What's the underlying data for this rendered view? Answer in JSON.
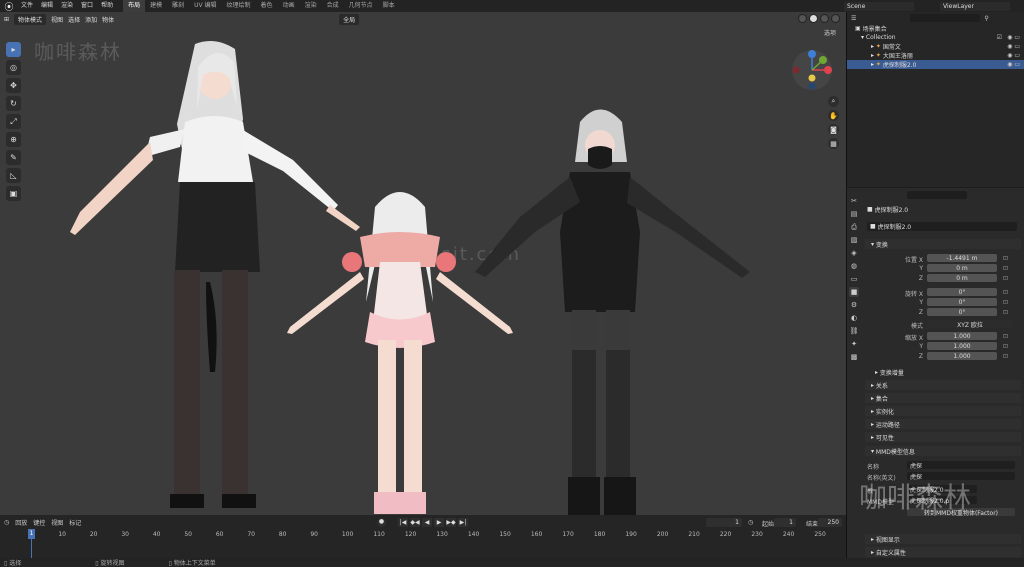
{
  "menu": {
    "file": "文件",
    "edit": "编辑",
    "render": "渲染",
    "window": "窗口",
    "help": "帮助"
  },
  "workspaces": [
    "布局",
    "建模",
    "雕刻",
    "UV 编辑",
    "纹理绘制",
    "着色",
    "动画",
    "渲染",
    "合成",
    "几何节点",
    "脚本"
  ],
  "scene": {
    "name": "Scene",
    "view_layer": "ViewLayer"
  },
  "viewport": {
    "mode": "物体模式",
    "menus": [
      "视图",
      "选择",
      "添加",
      "物体"
    ],
    "transform": "全局",
    "options": "选项"
  },
  "watermarks": [
    "咖啡森林",
    "ssit.com"
  ],
  "outliner": {
    "title": "场景集合",
    "rows": [
      {
        "label": "Collection",
        "indent": 14
      },
      {
        "label": "国常文",
        "indent": 24
      },
      {
        "label": "大国王洛丽",
        "indent": 24
      },
      {
        "label": "虎探制服2.0",
        "indent": 24,
        "selected": true
      }
    ]
  },
  "properties": {
    "object_name": "虎探制服2.0",
    "mesh_name": "虎探制服2.0",
    "transform_label": "变换",
    "location": {
      "label": "位置 X",
      "x": "-1.4491 m",
      "y": "0 m",
      "z": "0 m"
    },
    "rotation": {
      "label": "旋转 X",
      "x": "0°",
      "y": "0°",
      "z": "0°"
    },
    "mode": {
      "label": "模式",
      "value": "XYZ 欧拉"
    },
    "scale": {
      "label": "缩放 X",
      "x": "1.000",
      "y": "1.000",
      "z": "1.000"
    },
    "axes": {
      "y": "Y",
      "z": "Z"
    },
    "delta": "变换增量",
    "sections": [
      "关系",
      "集合",
      "实例化",
      "运动路径",
      "可见性"
    ],
    "mmd": {
      "title": "MMD模型信息",
      "name_label": "名称",
      "name_value": "虎探",
      "name_en_label": "名称(英文)",
      "name_en_value": "虎探",
      "root_label": "根",
      "root_value": "虎探制服2.0",
      "mesh_label": "MMD模型",
      "mesh_value": "虎探制服2.0.p",
      "extra": "转到MMD权重物体(Factor)"
    },
    "bottom_sections": [
      "视图显示",
      "自定义属性"
    ]
  },
  "timeline": {
    "menus": [
      "回放",
      "键控",
      "视图",
      "标记"
    ],
    "current_frame": "1",
    "start_label": "起始",
    "start": "1",
    "end_label": "结束",
    "end": "250",
    "ticks": [
      "1",
      "10",
      "20",
      "30",
      "40",
      "50",
      "60",
      "70",
      "80",
      "90",
      "100",
      "110",
      "120",
      "130",
      "140",
      "150",
      "160",
      "170",
      "180",
      "190",
      "200",
      "210",
      "220",
      "230",
      "240",
      "250"
    ]
  },
  "status": {
    "select": "选择",
    "rotate": "旋转视图",
    "context": "物体上下文菜单"
  },
  "colors": {
    "accent": "#4772b3",
    "x_axis": "#e0424e",
    "y_axis": "#6ea830",
    "z_axis": "#3c7ed8"
  }
}
